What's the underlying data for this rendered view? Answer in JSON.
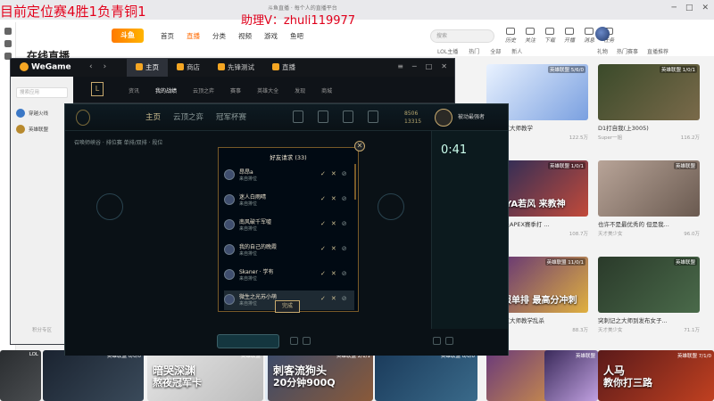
{
  "overlay": {
    "stream_title": "目前定位赛4胜1负青铜1",
    "assistant": "助理V：zhuli119977"
  },
  "browser": {
    "tab_text": "斗鱼直播 · 每个人的直播平台",
    "site_logo": "斗鱼",
    "nav": [
      "首页",
      "直播",
      "分类",
      "视频",
      "游戏",
      "鱼吧"
    ],
    "search_placeholder": "搜索",
    "top_icons": [
      "历史",
      "关注",
      "下载",
      "开播",
      "消息",
      "任务"
    ],
    "page_title": "在线直播",
    "subnav": [
      "LOL主播",
      "热门",
      "全部",
      "新人"
    ],
    "subnav_right": [
      "礼物",
      "热门赛事",
      "直播推荐"
    ]
  },
  "cards": [
    {
      "tag": "英雄联盟 5/6/0",
      "overlay": "",
      "title": "王者一区大师教学",
      "meta_left": "英雄联盟",
      "meta_right": "122.5万",
      "colors": [
        "#e9f2ff",
        "#7aa0e0"
      ]
    },
    {
      "tag": "英雄联盟 1/0/1",
      "overlay": "",
      "title": "D1打自我(上3005)",
      "meta_left": "Super一姐",
      "meta_right": "116.2万",
      "colors": [
        "#3a4a2a",
        "#7a6a4a"
      ]
    },
    {
      "tag": "英雄联盟 1/0/1",
      "overlay": "YAYA若风 来教神",
      "title": "全民娱乐APEX赛季打 ...",
      "meta_left": "英雄联盟",
      "meta_right": "108.7万",
      "colors": [
        "#1f2a5a",
        "#c24a3a"
      ]
    },
    {
      "tag": "英雄联盟",
      "overlay": "",
      "title": "也许不是最优秀的 但是我...",
      "meta_left": "天才美少女",
      "meta_right": "96.0万",
      "colors": [
        "#b8a498",
        "#6a5a50"
      ]
    },
    {
      "tag": "英雄联盟 11/0/1",
      "overlay": "国服单排 最高分冲刺",
      "title": "王者一区大师教学乱杀",
      "meta_left": "教学一哥",
      "meta_right": "88.3万",
      "colors": [
        "#5a2a7a",
        "#e0b040"
      ]
    },
    {
      "tag": "英雄联盟",
      "overlay": "",
      "title": "突刺记之大师到发布女子...",
      "meta_left": "天才美少女",
      "meta_right": "71.1万",
      "colors": [
        "#2a3a2a",
        "#4a6a4a"
      ]
    }
  ],
  "bottom_cards": [
    {
      "tag": "LOL",
      "big": "",
      "big2": "",
      "colors": [
        "#2a2d30",
        "#4a4d50"
      ]
    },
    {
      "tag": "英雄联盟 0/0/0",
      "big": "",
      "big2": "",
      "colors": [
        "#1a2330",
        "#3a4a5a"
      ]
    },
    {
      "tag": "英雄联盟",
      "big": "暗哭深渊",
      "big2": "熬夜冠军卡",
      "colors": [
        "#e6e6e6",
        "#bbbbbb"
      ]
    },
    {
      "tag": "英雄联盟 4/0/6",
      "big": "",
      "big2": "",
      "colors": [
        "#e8f0f8",
        "#c8d8e8"
      ]
    },
    {
      "tag": "英雄联盟 2/1/1",
      "big": "刺客流狗头",
      "big2": "20分钟900Q",
      "colors": [
        "#3a4a6a",
        "#8a5a3a"
      ]
    },
    {
      "tag": "英雄联盟 0/0/0",
      "big": "",
      "big2": "",
      "colors": [
        "#1a3a5a",
        "#3a6a8a"
      ]
    },
    {
      "tag": "英雄联盟",
      "big": "",
      "big2": "",
      "colors": [
        "#6a3a7a",
        "#e0a040"
      ]
    },
    {
      "tag": "英雄联盟",
      "big": "",
      "big2": "",
      "colors": [
        "#3a2a5a",
        "#c0a0e0"
      ]
    },
    {
      "tag": "英雄联盟 7/1/0",
      "big": "人马",
      "big2": "教你打三路",
      "colors": [
        "#5a1a1a",
        "#c04020"
      ]
    }
  ],
  "wegame": {
    "logo": "WeGame",
    "tabs": [
      "主页",
      "商店",
      "先锋测试",
      "直播"
    ],
    "search_placeholder": "搜索应用",
    "side_items": [
      "穿越火线",
      "英雄联盟"
    ],
    "side_footer": "积分专区",
    "game_nav": [
      "资讯",
      "我的战绩",
      "云顶之弈",
      "赛事",
      "英雄大全",
      "发现",
      "商城"
    ]
  },
  "lol": {
    "tabs": [
      "主页",
      "云顶之弈",
      "冠军杯赛"
    ],
    "currency_be": "8506",
    "currency_rp": "13315",
    "user": "被动最强者",
    "breadcrumb": "召唤师峡谷 · 排位赛 单排/双排 · 段位",
    "timer": "0:41"
  },
  "modal": {
    "title": "好友请求 (33)",
    "requests": [
      {
        "name": "昂昂a",
        "sub": "来自排位"
      },
      {
        "name": "迷人白雨晴",
        "sub": "来自排位"
      },
      {
        "name": "南风破千军嘘",
        "sub": "来自排位"
      },
      {
        "name": "我的自己的晚霞",
        "sub": "来自排位"
      },
      {
        "name": "Skaner · 学有",
        "sub": "来自排位"
      },
      {
        "name": "微生之光苏小萌",
        "sub": "来自排位"
      }
    ],
    "done": "完成"
  },
  "colors": {
    "overlay_red": "#e0001b",
    "lol_gold": "#c8aa6e",
    "douyu_orange": "#ff6a00"
  }
}
